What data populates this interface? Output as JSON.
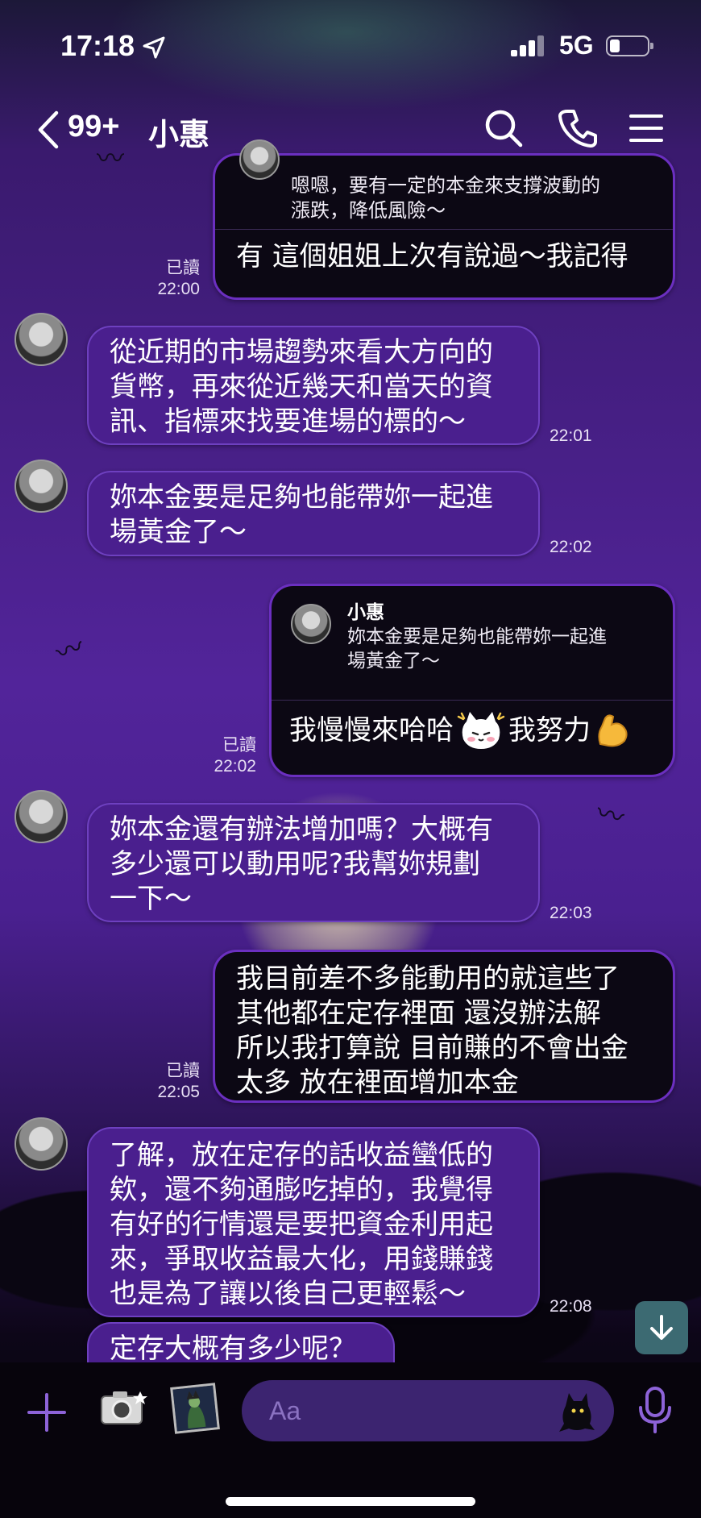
{
  "status_bar": {
    "time": "17:18",
    "network": "5G"
  },
  "header": {
    "back_icon": "chevron-left-icon",
    "unread_count": "99+",
    "title": "小惠"
  },
  "messages": [
    {
      "side": "right",
      "quote_text": "嗯嗯，要有一定的本金來支撐波動的\n漲跌，降低風險～",
      "text": "有 這個姐姐上次有說過～我記得",
      "read": "已讀",
      "time": "22:00"
    },
    {
      "side": "left",
      "text": "從近期的市場趨勢來看大方向的\n貨幣，再來從近幾天和當天的資\n訊、指標來找要進場的標的～",
      "time": "22:01"
    },
    {
      "side": "left",
      "text": "妳本金要是足夠也能帶妳一起進\n場黃金了～",
      "time": "22:02"
    },
    {
      "side": "right",
      "quote_name": "小惠",
      "quote_text": "妳本金要是足夠也能帶妳一起進\n場黃金了～",
      "text_a": "我慢慢來哈哈",
      "text_b": "我努力",
      "read": "已讀",
      "time": "22:02"
    },
    {
      "side": "left",
      "text": "妳本金還有辦法增加嗎？大概有\n多少還可以動用呢?我幫妳規劃\n一下～",
      "time": "22:03"
    },
    {
      "side": "right",
      "text": "我目前差不多能動用的就這些了\n其他都在定存裡面 還沒辦法解\n所以我打算說 目前賺的不會出金\n太多 放在裡面增加本金",
      "read": "已讀",
      "time": "22:05"
    },
    {
      "side": "left",
      "text": "了解，放在定存的話收益蠻低的\n欸，還不夠通膨吃掉的，我覺得\n有好的行情還是要把資金利用起\n來，爭取收益最大化，用錢賺錢\n也是為了讓以後自己更輕鬆～",
      "time": "22:08"
    },
    {
      "side": "left",
      "text": "定存大概有多少呢？"
    }
  ],
  "input": {
    "placeholder": "Aa"
  },
  "icons": {
    "search": "search-icon",
    "call": "phone-icon",
    "menu": "menu-icon",
    "add": "plus-icon",
    "camera": "camera-icon",
    "image": "image-icon",
    "emoji": "cat-sticker-icon",
    "voice": "microphone-icon",
    "scroll_down": "arrow-down-icon"
  },
  "colors": {
    "left_bubble": "#4a1f8e",
    "right_bubble": "#0c0814",
    "accent": "#8d63d8"
  }
}
